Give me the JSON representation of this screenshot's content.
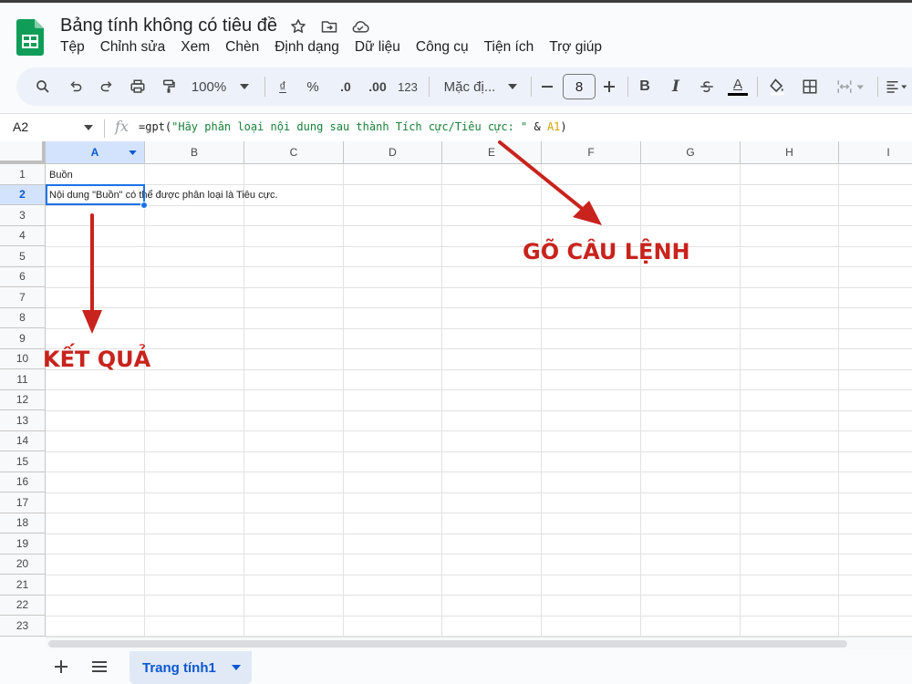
{
  "document": {
    "title": "Bảng tính không có tiêu đề",
    "title_icons": [
      "star-icon",
      "move-to-folder-icon",
      "cloud-saved-icon"
    ]
  },
  "menu": [
    "Tệp",
    "Chỉnh sửa",
    "Xem",
    "Chèn",
    "Định dạng",
    "Dữ liệu",
    "Công cụ",
    "Tiện ích",
    "Trợ giúp"
  ],
  "toolbar": {
    "zoom": "100%",
    "currency": "₫",
    "percent": "%",
    "decimal_decrease": ".0",
    "decimal_increase": ".00",
    "number_format": "123",
    "font": "Mặc đị...",
    "font_size": "8",
    "bold": "B",
    "italic": "I",
    "text_color": "A",
    "text_color_value": "#000000"
  },
  "formula_bar": {
    "name_box": "A2",
    "fx": "fx",
    "formula_prefix": "=gpt(",
    "formula_string": "\"Hãy phân loại nội dung sau thành Tích cực/Tiêu cực: \"",
    "formula_amp": " & ",
    "formula_ref": "A1",
    "formula_suffix": ")"
  },
  "grid": {
    "columns": [
      "A",
      "B",
      "C",
      "D",
      "E",
      "F",
      "G",
      "H",
      "I"
    ],
    "rows": [
      "1",
      "2",
      "3",
      "4",
      "5",
      "6",
      "7",
      "8",
      "9",
      "10",
      "11",
      "12",
      "13",
      "14",
      "15",
      "16",
      "17",
      "18",
      "19",
      "20",
      "21",
      "22",
      "23"
    ],
    "selected_column": "A",
    "selected_row": "2",
    "cells": {
      "A1": "Buồn",
      "A2": "Nội dung \"Buồn\" có thể được phân loại là Tiêu cực."
    }
  },
  "annotations": {
    "formula_callout": "GÕ CÂU LỆNH",
    "result_callout": "KẾT QUẢ",
    "color": "#c8231d"
  },
  "sheets": {
    "tabs": [
      {
        "label": "Trang tính1",
        "active": true
      }
    ]
  },
  "colors": {
    "accent": "#0b57d0",
    "selection": "#1a73e8",
    "toolbar_bg": "#edf2fa"
  }
}
